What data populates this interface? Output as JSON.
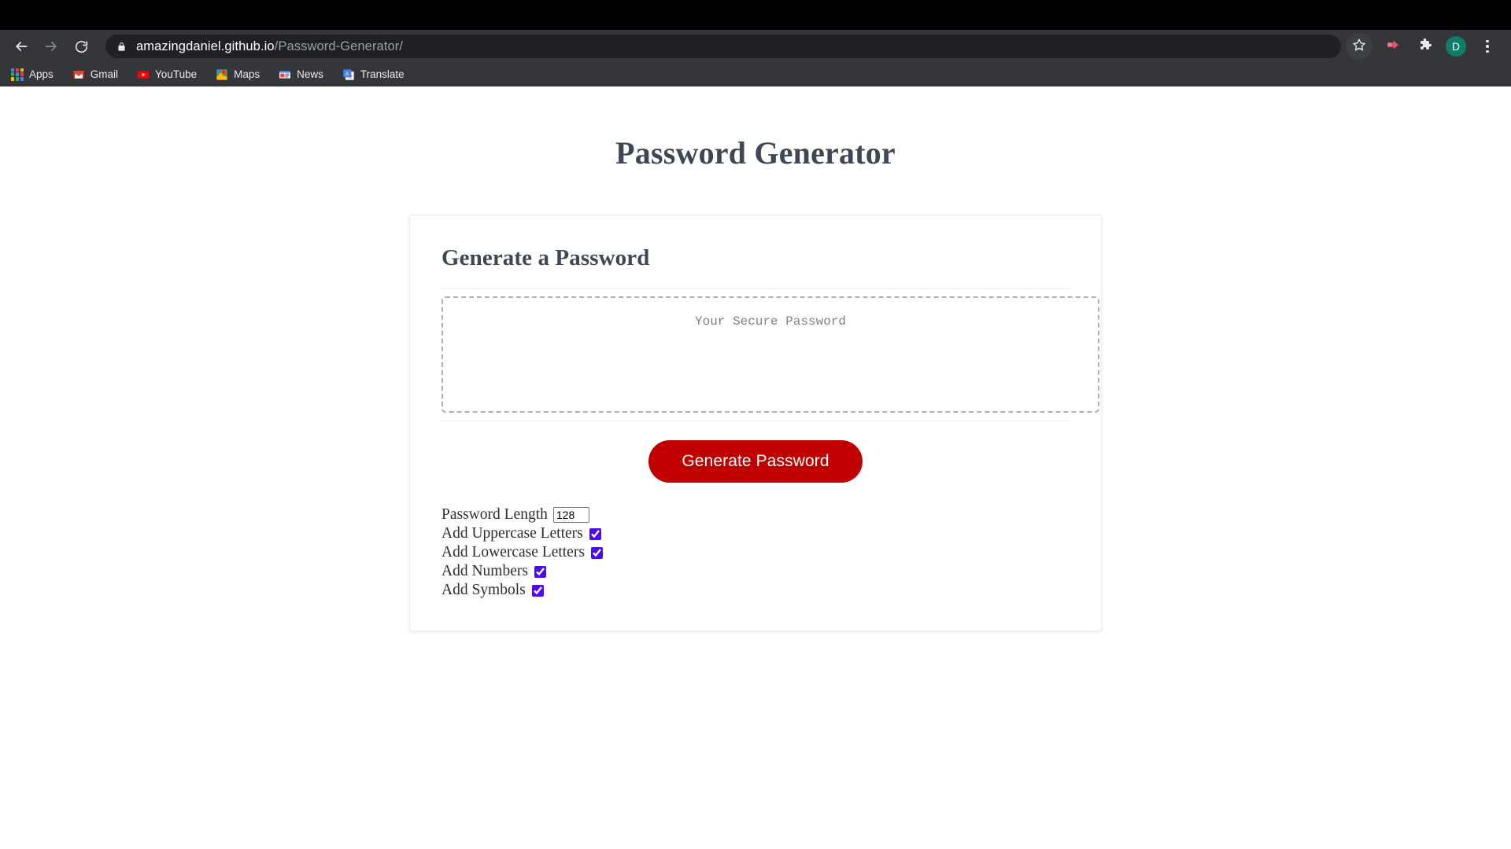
{
  "browser": {
    "nav": {
      "back_icon": "arrow-left-icon",
      "forward_icon": "arrow-right-icon",
      "reload_icon": "reload-icon"
    },
    "omnibox": {
      "lock_icon": "lock-icon",
      "host": "amazingdaniel.github.io",
      "path": "/Password-Generator/",
      "full_url": "amazingdaniel.github.io/Password-Generator/"
    },
    "actions": {
      "star_icon": "star-icon",
      "extension_icon": "extension-arrow-icon",
      "puzzle_icon": "puzzle-piece-icon",
      "avatar_initial": "D",
      "avatar_color": "#0f7d6b",
      "menu_icon": "three-dots-menu-icon"
    },
    "bookmarks": [
      {
        "label": "Apps",
        "icon": "apps-grid-icon"
      },
      {
        "label": "Gmail",
        "icon": "gmail-icon"
      },
      {
        "label": "YouTube",
        "icon": "youtube-icon"
      },
      {
        "label": "Maps",
        "icon": "maps-pin-icon"
      },
      {
        "label": "News",
        "icon": "news-icon"
      },
      {
        "label": "Translate",
        "icon": "translate-icon"
      }
    ]
  },
  "page": {
    "title": "Password Generator",
    "card": {
      "heading": "Generate a Password",
      "password_field": {
        "value": "",
        "placeholder": "Your Secure Password"
      },
      "generate_button": "Generate Password",
      "options": {
        "length": {
          "label": "Password Length",
          "value": "128"
        },
        "checkboxes": [
          {
            "label": "Add Uppercase Letters",
            "checked": true
          },
          {
            "label": "Add Lowercase Letters",
            "checked": true
          },
          {
            "label": "Add Numbers",
            "checked": true
          },
          {
            "label": "Add Symbols",
            "checked": true
          }
        ]
      }
    }
  },
  "colors": {
    "accent_button": "#c00000",
    "heading_text": "#3e4855",
    "checkbox_accent": "#4b0de8",
    "chrome_toolbar": "#35363a",
    "omnibox_bg": "#202124"
  }
}
